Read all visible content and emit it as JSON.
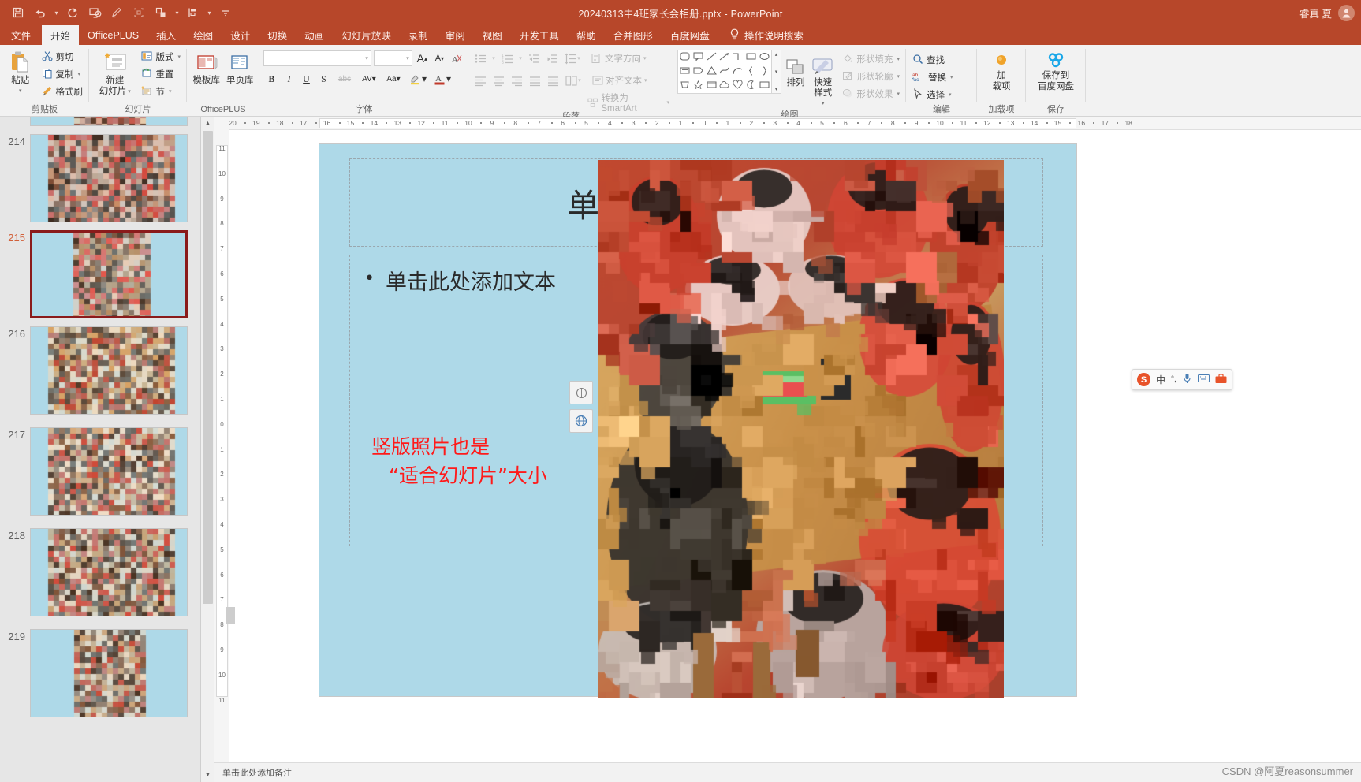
{
  "titlebar": {
    "document_title": "20240313中4班家长会相册.pptx  -  PowerPoint",
    "user_name": "睿真 夏",
    "qat": [
      {
        "name": "save",
        "icon": "save-icon"
      },
      {
        "name": "undo",
        "icon": "undo-icon"
      },
      {
        "name": "redo",
        "icon": "redo-icon"
      },
      {
        "name": "start-slideshow",
        "icon": "slideshow-icon"
      },
      {
        "name": "ink",
        "icon": "pen-icon"
      },
      {
        "name": "selection-pane",
        "icon": "selection-icon"
      },
      {
        "name": "arrange",
        "icon": "arrange-icon"
      },
      {
        "name": "align",
        "icon": "align-icon"
      },
      {
        "name": "customize",
        "icon": "chevron-down-icon"
      }
    ]
  },
  "tabs": [
    {
      "label": "文件",
      "active": false
    },
    {
      "label": "开始",
      "active": true
    },
    {
      "label": "OfficePLUS",
      "active": false
    },
    {
      "label": "插入",
      "active": false
    },
    {
      "label": "绘图",
      "active": false
    },
    {
      "label": "设计",
      "active": false
    },
    {
      "label": "切换",
      "active": false
    },
    {
      "label": "动画",
      "active": false
    },
    {
      "label": "幻灯片放映",
      "active": false
    },
    {
      "label": "录制",
      "active": false
    },
    {
      "label": "审阅",
      "active": false
    },
    {
      "label": "视图",
      "active": false
    },
    {
      "label": "开发工具",
      "active": false
    },
    {
      "label": "帮助",
      "active": false
    },
    {
      "label": "合并图形",
      "active": false
    },
    {
      "label": "百度网盘",
      "active": false
    }
  ],
  "tellme": "操作说明搜索",
  "ribbon": {
    "clipboard": {
      "label": "剪贴板",
      "paste": "粘贴",
      "cut": "剪切",
      "copy": "复制",
      "format_painter": "格式刷"
    },
    "slides": {
      "label": "幻灯片",
      "new_slide": "新建\n幻灯片",
      "new_slide_l1": "新建",
      "new_slide_l2": "幻灯片",
      "layout": "版式",
      "reset": "重置",
      "section": "节"
    },
    "officeplus": {
      "label": "OfficePLUS",
      "template_library": "模板库",
      "page_library": "单页库"
    },
    "font": {
      "label": "字体",
      "font_name": "",
      "font_size": "",
      "grow": "A",
      "shrink": "A",
      "clear_format": "A",
      "bold": "B",
      "italic": "I",
      "underline": "U",
      "strikethrough": "S",
      "shadow": "abc",
      "char_spacing": "AV",
      "case": "Aa",
      "highlight": "A",
      "font_color": "A"
    },
    "paragraph": {
      "label": "段落",
      "text_direction": "文字方向",
      "align_text": "对齐文本",
      "convert_smartart": "转换为 SmartArt"
    },
    "drawing": {
      "label": "绘图",
      "arrange": "排列",
      "quick_styles": "快速样式",
      "shape_fill": "形状填充",
      "shape_outline": "形状轮廓",
      "shape_effects": "形状效果"
    },
    "editing": {
      "label": "编辑",
      "find": "查找",
      "replace": "替换",
      "select": "选择"
    },
    "addins": {
      "label": "加载项",
      "button_l1": "加",
      "button_l2": "载项"
    },
    "save_group": {
      "label": "保存",
      "button_l1": "保存到",
      "button_l2": "百度网盘"
    }
  },
  "slide_panel": {
    "slides": [
      {
        "number": "",
        "selected": false
      },
      {
        "number": "214",
        "selected": false
      },
      {
        "number": "215",
        "selected": true
      },
      {
        "number": "216",
        "selected": false
      },
      {
        "number": "217",
        "selected": false
      },
      {
        "number": "218",
        "selected": false
      },
      {
        "number": "219",
        "selected": false
      }
    ]
  },
  "hruler_ticks": [
    "20",
    "19",
    "18",
    "17",
    "16",
    "15",
    "14",
    "13",
    "12",
    "11",
    "10",
    "9",
    "8",
    "7",
    "6",
    "5",
    "4",
    "3",
    "2",
    "1",
    "0",
    "1",
    "2",
    "3",
    "4",
    "5",
    "6",
    "7",
    "8",
    "9",
    "10",
    "11",
    "12",
    "13",
    "14",
    "15",
    "16",
    "17",
    "18"
  ],
  "vruler_ticks": [
    "11",
    "10",
    "9",
    "8",
    "7",
    "6",
    "5",
    "4",
    "3",
    "2",
    "1",
    "0",
    "1",
    "2",
    "3",
    "4",
    "5",
    "6",
    "7",
    "8",
    "9",
    "10",
    "11"
  ],
  "slide": {
    "title_placeholder": "单击此处添加标题",
    "body_placeholder": "单击此处添加文本",
    "annotation_line1": "竖版照片也是",
    "annotation_line2": "“适合幻灯片”大小",
    "annotation_color": "#ff1a1a",
    "background_color": "#aed9e8",
    "float_icons": [
      "layout-options-icon",
      "translate-icon"
    ]
  },
  "ime": {
    "logo": "S",
    "mode": "中",
    "punctuation": "°,",
    "mic": "mic-icon",
    "keyboard": "keyboard-icon",
    "toolbox": "toolbox-icon"
  },
  "statusbar": {
    "notes": "单击此处添加备注"
  },
  "watermark": "CSDN @阿夏reasonsummer"
}
